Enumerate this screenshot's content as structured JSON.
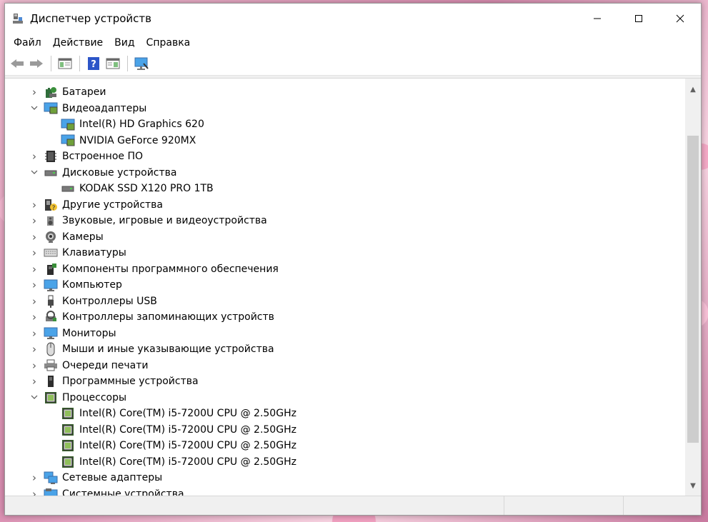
{
  "window": {
    "title": "Диспетчер устройств"
  },
  "menu": [
    "Файл",
    "Действие",
    "Вид",
    "Справка"
  ],
  "toolbar": [
    "back-icon",
    "forward-icon",
    "properties-pane-icon",
    "help-icon",
    "show-hide-console-tree-icon",
    "monitor-scan-icon"
  ],
  "tree": [
    {
      "label": "Батареи",
      "expand": "collapsed",
      "level": 0,
      "icon": "battery-icon"
    },
    {
      "label": "Видеоадаптеры",
      "expand": "expanded",
      "level": 0,
      "icon": "display-adapter-icon"
    },
    {
      "label": "Intel(R) HD Graphics 620",
      "expand": "none",
      "level": 1,
      "icon": "display-adapter-icon"
    },
    {
      "label": "NVIDIA GeForce 920MX",
      "expand": "none",
      "level": 1,
      "icon": "display-adapter-icon"
    },
    {
      "label": "Встроенное ПО",
      "expand": "collapsed",
      "level": 0,
      "icon": "firmware-icon"
    },
    {
      "label": "Дисковые устройства",
      "expand": "expanded",
      "level": 0,
      "icon": "disk-drive-icon"
    },
    {
      "label": "KODAK SSD X120 PRO 1TB",
      "expand": "none",
      "level": 1,
      "icon": "disk-drive-icon"
    },
    {
      "label": "Другие устройства",
      "expand": "collapsed",
      "level": 0,
      "icon": "unknown-device-icon"
    },
    {
      "label": "Звуковые, игровые и видеоустройства",
      "expand": "collapsed",
      "level": 0,
      "icon": "speaker-icon"
    },
    {
      "label": "Камеры",
      "expand": "collapsed",
      "level": 0,
      "icon": "camera-icon"
    },
    {
      "label": "Клавиатуры",
      "expand": "collapsed",
      "level": 0,
      "icon": "keyboard-icon"
    },
    {
      "label": "Компоненты программного обеспечения",
      "expand": "collapsed",
      "level": 0,
      "icon": "software-component-icon"
    },
    {
      "label": "Компьютер",
      "expand": "collapsed",
      "level": 0,
      "icon": "computer-icon"
    },
    {
      "label": "Контроллеры USB",
      "expand": "collapsed",
      "level": 0,
      "icon": "usb-icon"
    },
    {
      "label": "Контроллеры запоминающих устройств",
      "expand": "collapsed",
      "level": 0,
      "icon": "storage-controller-icon"
    },
    {
      "label": "Мониторы",
      "expand": "collapsed",
      "level": 0,
      "icon": "monitor-icon"
    },
    {
      "label": "Мыши и иные указывающие устройства",
      "expand": "collapsed",
      "level": 0,
      "icon": "mouse-icon"
    },
    {
      "label": "Очереди печати",
      "expand": "collapsed",
      "level": 0,
      "icon": "printer-icon"
    },
    {
      "label": "Программные устройства",
      "expand": "collapsed",
      "level": 0,
      "icon": "software-device-icon"
    },
    {
      "label": "Процессоры",
      "expand": "expanded",
      "level": 0,
      "icon": "processor-icon"
    },
    {
      "label": "Intel(R) Core(TM) i5-7200U CPU @ 2.50GHz",
      "expand": "none",
      "level": 1,
      "icon": "processor-icon"
    },
    {
      "label": "Intel(R) Core(TM) i5-7200U CPU @ 2.50GHz",
      "expand": "none",
      "level": 1,
      "icon": "processor-icon"
    },
    {
      "label": "Intel(R) Core(TM) i5-7200U CPU @ 2.50GHz",
      "expand": "none",
      "level": 1,
      "icon": "processor-icon"
    },
    {
      "label": "Intel(R) Core(TM) i5-7200U CPU @ 2.50GHz",
      "expand": "none",
      "level": 1,
      "icon": "processor-icon"
    },
    {
      "label": "Сетевые адаптеры",
      "expand": "collapsed",
      "level": 0,
      "icon": "network-adapter-icon"
    },
    {
      "label": "Системные устройства",
      "expand": "collapsed",
      "level": 0,
      "icon": "system-device-icon"
    }
  ]
}
